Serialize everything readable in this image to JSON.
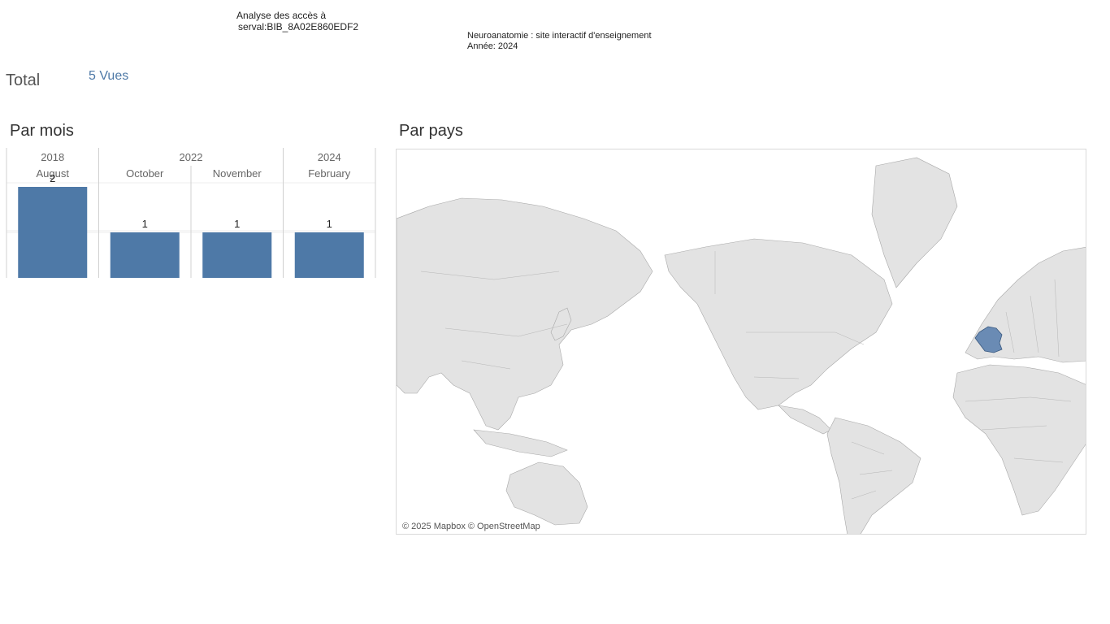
{
  "header": {
    "title_line1": "Analyse des accès à",
    "title_line2": "serval:BIB_8A02E860EDF2",
    "site_title": "Neuroanatomie : site interactif d'enseignement",
    "year_line": "Année: 2024"
  },
  "total": {
    "label": "Total",
    "value": "5 Vues"
  },
  "sections": {
    "by_month": "Par mois",
    "by_country": "Par pays"
  },
  "chart_data": {
    "type": "bar",
    "years": [
      {
        "year": "2018",
        "months": [
          "August"
        ]
      },
      {
        "year": "2022",
        "months": [
          "October",
          "November"
        ]
      },
      {
        "year": "2024",
        "months": [
          "February"
        ]
      }
    ],
    "categories": [
      "August",
      "October",
      "November",
      "February"
    ],
    "values": [
      2,
      1,
      1,
      1
    ],
    "ylim": [
      0,
      2
    ],
    "grid": true,
    "bar_color": "#4e79a7"
  },
  "map": {
    "highlighted_countries": [
      "France"
    ],
    "highlight_color": "#6a8bb4",
    "land_color": "#e3e3e3",
    "border_color": "#9a9a9a",
    "credit": "© 2025 Mapbox © OpenStreetMap"
  }
}
